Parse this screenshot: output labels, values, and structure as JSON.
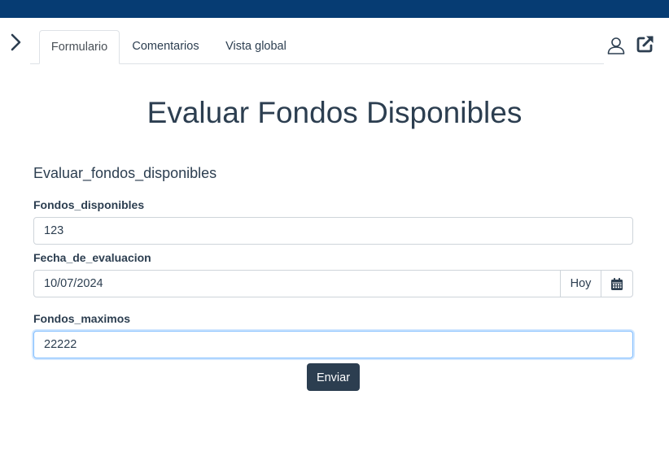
{
  "tabs": [
    {
      "label": "Formulario",
      "active": true
    },
    {
      "label": "Comentarios",
      "active": false
    },
    {
      "label": "Vista global",
      "active": false
    }
  ],
  "icons": {
    "sidebar_toggle": "chevron-right-icon",
    "user": "user-icon",
    "external": "external-link-icon",
    "calendar": "calendar-icon"
  },
  "colors": {
    "header_bar": "#063c73",
    "primary": "#2c3e50",
    "focus_border": "#80bdff"
  },
  "page": {
    "title": "Evaluar Fondos Disponibles",
    "subtitle": "Evaluar_fondos_disponibles"
  },
  "form": {
    "fondos_disponibles": {
      "label": "Fondos_disponibles",
      "value": "123"
    },
    "fecha_de_evaluacion": {
      "label": "Fecha_de_evaluacion",
      "value": "10/07/2024",
      "today_label": "Hoy"
    },
    "fondos_maximos": {
      "label": "Fondos_maximos",
      "value": "22222"
    },
    "submit_label": "Enviar"
  }
}
